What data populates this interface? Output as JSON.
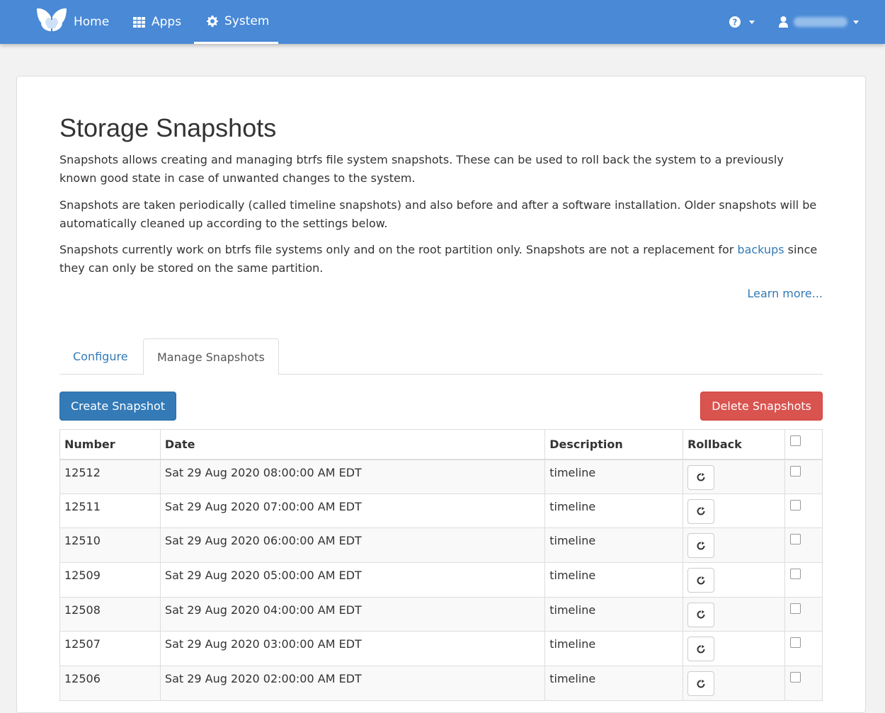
{
  "navbar": {
    "brand_color": "#4989d6",
    "home_label": "Home",
    "apps_label": "Apps",
    "system_label": "System",
    "help_icon": "question-circle-icon",
    "user_icon": "user-icon"
  },
  "page": {
    "title": "Storage Snapshots",
    "para1": "Snapshots allows creating and managing btrfs file system snapshots. These can be used to roll back the system to a previously known good state in case of unwanted changes to the system.",
    "para2": "Snapshots are taken periodically (called timeline snapshots) and also before and after a software installation. Older snapshots will be automatically cleaned up according to the settings below.",
    "para3_before": "Snapshots currently work on btrfs file systems only and on the root partition only. Snapshots are not a replacement for ",
    "para3_link": "backups",
    "para3_after": " since they can only be stored on the same partition.",
    "learn_more": "Learn more..."
  },
  "tabs": {
    "configure": "Configure",
    "manage": "Manage Snapshots",
    "active": "manage"
  },
  "actions": {
    "create": "Create Snapshot",
    "delete": "Delete Snapshots"
  },
  "table": {
    "headers": [
      "Number",
      "Date",
      "Description",
      "Rollback"
    ],
    "rows": [
      {
        "number": "12512",
        "date": "Sat 29 Aug 2020 08:00:00 AM EDT",
        "description": "timeline"
      },
      {
        "number": "12511",
        "date": "Sat 29 Aug 2020 07:00:00 AM EDT",
        "description": "timeline"
      },
      {
        "number": "12510",
        "date": "Sat 29 Aug 2020 06:00:00 AM EDT",
        "description": "timeline"
      },
      {
        "number": "12509",
        "date": "Sat 29 Aug 2020 05:00:00 AM EDT",
        "description": "timeline"
      },
      {
        "number": "12508",
        "date": "Sat 29 Aug 2020 04:00:00 AM EDT",
        "description": "timeline"
      },
      {
        "number": "12507",
        "date": "Sat 29 Aug 2020 03:00:00 AM EDT",
        "description": "timeline"
      },
      {
        "number": "12506",
        "date": "Sat 29 Aug 2020 02:00:00 AM EDT",
        "description": "timeline"
      }
    ]
  }
}
